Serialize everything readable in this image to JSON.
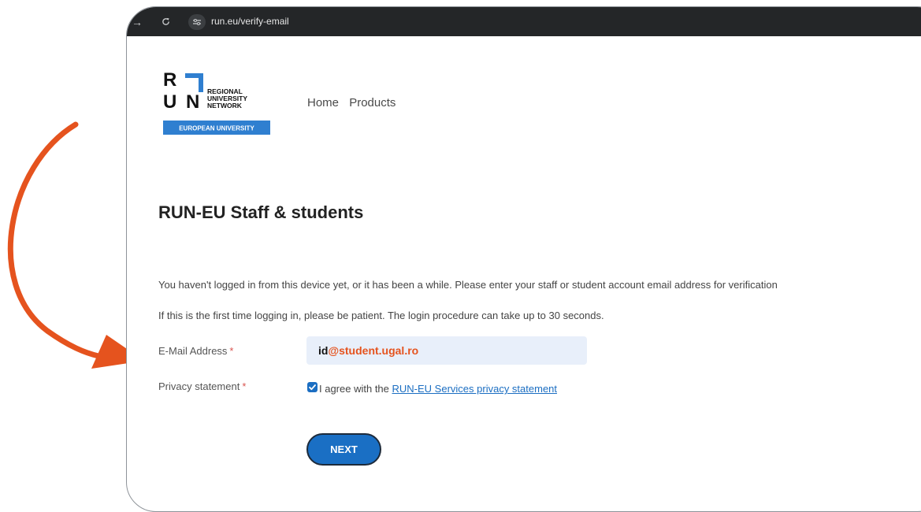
{
  "browser": {
    "url": "run.eu/verify-email"
  },
  "logo": {
    "letters": [
      "R",
      "U",
      "N"
    ],
    "lines": [
      "REGIONAL",
      "UNIVERSITY",
      "NETWORK"
    ],
    "banner": "EUROPEAN UNIVERSITY"
  },
  "nav": {
    "items": [
      "Home",
      "Products"
    ]
  },
  "page": {
    "title": "RUN-EU Staff & students",
    "paragraph1": "You haven't logged in from this device yet, or it has been a while. Please enter your staff or student account email address for verification",
    "paragraph2": "If this is the first time logging in, please be patient. The login procedure can take up to 30 seconds."
  },
  "form": {
    "email_label": "E-Mail Address",
    "email_value_user": "id",
    "email_value_domain": "@student.ugal.ro",
    "privacy_label": "Privacy statement",
    "required_mark": "*",
    "privacy_checked": true,
    "privacy_text": "I agree with the",
    "privacy_link": "RUN-EU Services privacy statement",
    "submit_label": "NEXT"
  },
  "colors": {
    "accent": "#1b6ec2",
    "annotation_arrow": "#e5531e",
    "email_domain": "#e5531e",
    "toolbar": "#242628"
  }
}
